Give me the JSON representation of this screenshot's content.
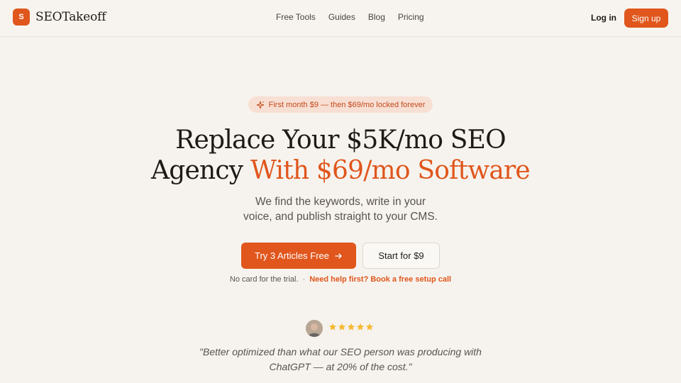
{
  "brand": {
    "logo_letter": "S",
    "name": "SEOTakeoff",
    "accent_color": "#e0561c"
  },
  "nav": {
    "links": [
      "Free Tools",
      "Guides",
      "Blog",
      "Pricing"
    ],
    "login": "Log in",
    "signup": "Sign up"
  },
  "hero": {
    "badge": "First month $9 — then $69/mo locked forever",
    "badge_icon": "sparkle-icon",
    "headline_line1": "Replace Your $5K/mo SEO",
    "headline_line2_plain": "Agency",
    "headline_line2_accent": "With $69/mo Software",
    "subtitle_line1": "We find the keywords, write in your",
    "subtitle_line2": "voice, and publish straight to your CMS.",
    "cta_primary": "Try 3 Articles Free",
    "cta_primary_icon": "arrow-right-icon",
    "cta_secondary": "Start for $9",
    "trial_note": "No card for the trial.",
    "separator": "·",
    "help_link": "Need help first? Book a free setup call"
  },
  "testimonial": {
    "rating": 5,
    "star_color": "#f5b82e",
    "quote_line1": "\"Better optimized than what our SEO person was producing with",
    "quote_line2": "ChatGPT — at 20% of the cost.\""
  }
}
